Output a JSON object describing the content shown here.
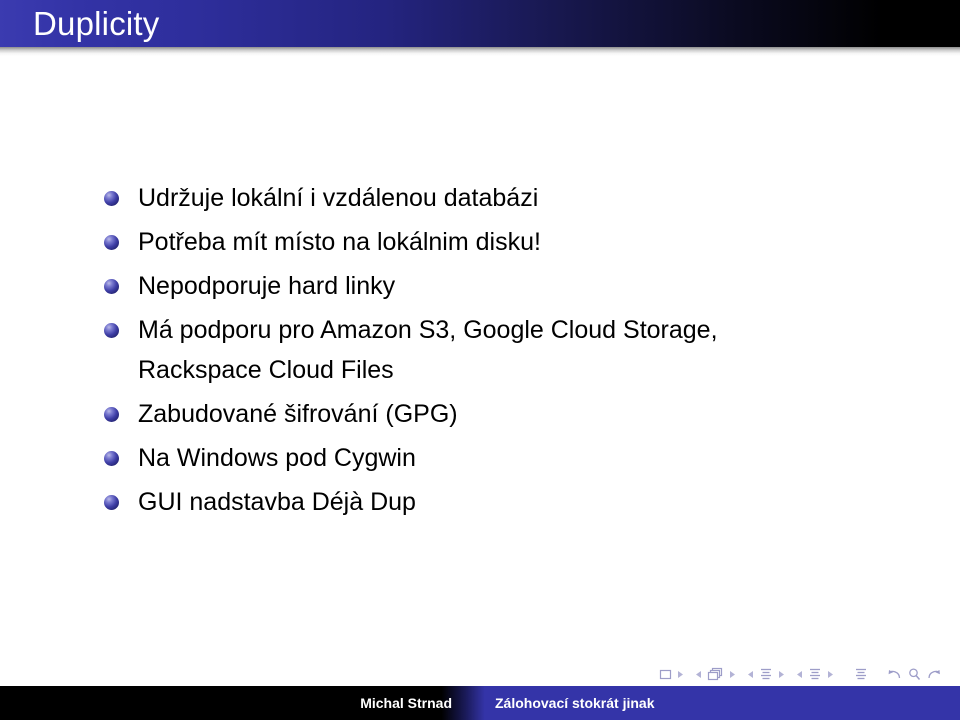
{
  "header": {
    "title": "Duplicity",
    "gradient_from": "#3b3bb0",
    "gradient_to": "#000000",
    "title_color": "#ffffff"
  },
  "body": {
    "background": "#ffffff",
    "text_color": "#000000",
    "bullet_color": "#3e3ea6",
    "bullets": [
      {
        "text": "Udržuje lokální i vzdálenou databázi"
      },
      {
        "text": "Potřeba mít místo na lokálnim disku!"
      },
      {
        "text": "Nepodporuje hard linky"
      },
      {
        "text": "Má podporu pro Amazon S3, Google Cloud Storage,\nRackspace Cloud Files"
      },
      {
        "text": "Zabudované šifrování (GPG)"
      },
      {
        "text": "Na Windows pod Cygwin"
      },
      {
        "text": "GUI nadstavba Déjà Dup"
      }
    ]
  },
  "navigation": {
    "color": "#9d9dc8",
    "icons": [
      "slide-frame-icon",
      "next-slide-arrow-icon",
      "prev-frame-arrow-icon",
      "frames-stack-icon",
      "next-frame-arrow-icon",
      "prev-subsection-arrow-icon",
      "subsection-lines-icon",
      "next-subsection-arrow-icon",
      "prev-section-arrow-icon",
      "section-lines-icon",
      "next-section-arrow-icon",
      "presentation-lines-icon",
      "back-arrow-icon",
      "search-magnifier-icon",
      "forward-arrow-icon"
    ]
  },
  "footer": {
    "author": "Michal Strnad",
    "subject": "Zálohovací stokrát jinak",
    "author_bg": "#000000",
    "subject_bg": "#3434a8",
    "text_color": "#ffffff"
  }
}
